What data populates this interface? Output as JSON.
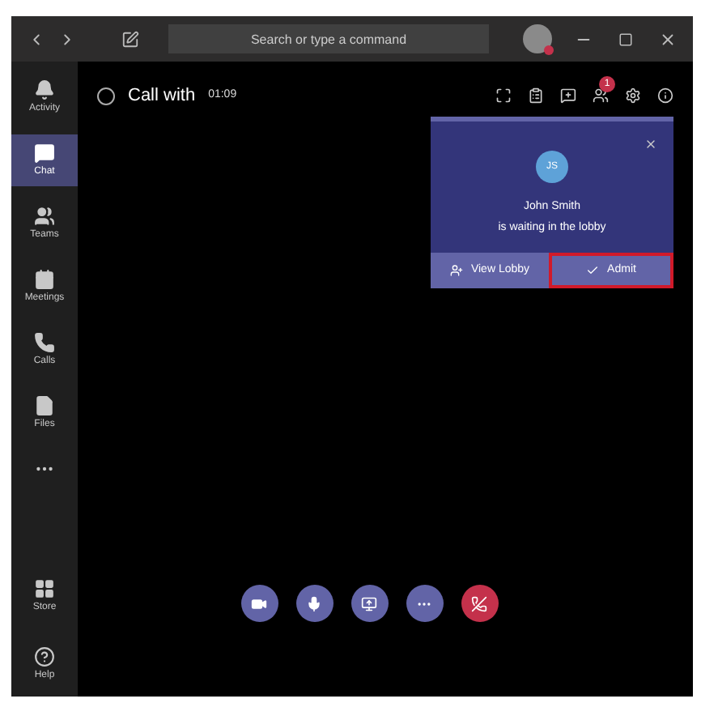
{
  "title_bar": {
    "search": {
      "placeholder": "Search or type a command"
    }
  },
  "sidebar": {
    "items": [
      {
        "label": "Activity",
        "selected": false
      },
      {
        "label": "Chat",
        "selected": true
      },
      {
        "label": "Teams",
        "selected": false
      },
      {
        "label": "Meetings",
        "selected": false
      },
      {
        "label": "Calls",
        "selected": false
      },
      {
        "label": "Files",
        "selected": false
      },
      {
        "selected": false
      }
    ],
    "bottom_items": [
      {
        "label": "Store",
        "selected": false
      },
      {
        "label": "Help",
        "selected": false
      }
    ]
  },
  "call": {
    "title": "Call with",
    "timer": "01:09",
    "participants_badge": "1"
  },
  "lobby_notice": {
    "initials": "JS",
    "name": "John Smith",
    "message": "is waiting in the lobby",
    "buttons": [
      {
        "label": "View Lobby",
        "kind": "view",
        "highlighted": false
      },
      {
        "label": "Admit",
        "kind": "admit",
        "highlighted": true
      }
    ]
  },
  "controls": [
    {
      "kind": "video"
    },
    {
      "kind": "mic"
    },
    {
      "kind": "share"
    },
    {
      "kind": "more"
    },
    {
      "kind": "hangup"
    }
  ]
}
